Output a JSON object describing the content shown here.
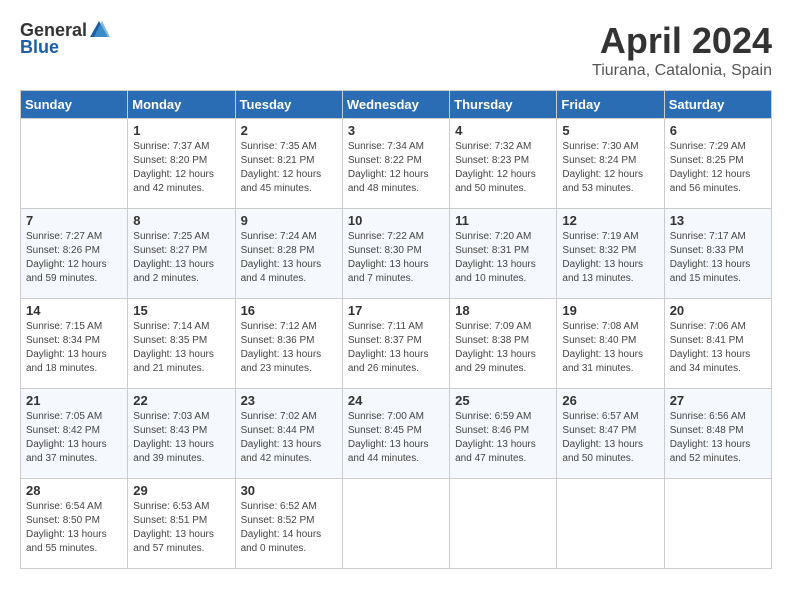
{
  "header": {
    "logo_general": "General",
    "logo_blue": "Blue",
    "main_title": "April 2024",
    "subtitle": "Tiurana, Catalonia, Spain"
  },
  "weekdays": [
    "Sunday",
    "Monday",
    "Tuesday",
    "Wednesday",
    "Thursday",
    "Friday",
    "Saturday"
  ],
  "weeks": [
    [
      {
        "num": "",
        "info": ""
      },
      {
        "num": "1",
        "info": "Sunrise: 7:37 AM\nSunset: 8:20 PM\nDaylight: 12 hours\nand 42 minutes."
      },
      {
        "num": "2",
        "info": "Sunrise: 7:35 AM\nSunset: 8:21 PM\nDaylight: 12 hours\nand 45 minutes."
      },
      {
        "num": "3",
        "info": "Sunrise: 7:34 AM\nSunset: 8:22 PM\nDaylight: 12 hours\nand 48 minutes."
      },
      {
        "num": "4",
        "info": "Sunrise: 7:32 AM\nSunset: 8:23 PM\nDaylight: 12 hours\nand 50 minutes."
      },
      {
        "num": "5",
        "info": "Sunrise: 7:30 AM\nSunset: 8:24 PM\nDaylight: 12 hours\nand 53 minutes."
      },
      {
        "num": "6",
        "info": "Sunrise: 7:29 AM\nSunset: 8:25 PM\nDaylight: 12 hours\nand 56 minutes."
      }
    ],
    [
      {
        "num": "7",
        "info": "Sunrise: 7:27 AM\nSunset: 8:26 PM\nDaylight: 12 hours\nand 59 minutes."
      },
      {
        "num": "8",
        "info": "Sunrise: 7:25 AM\nSunset: 8:27 PM\nDaylight: 13 hours\nand 2 minutes."
      },
      {
        "num": "9",
        "info": "Sunrise: 7:24 AM\nSunset: 8:28 PM\nDaylight: 13 hours\nand 4 minutes."
      },
      {
        "num": "10",
        "info": "Sunrise: 7:22 AM\nSunset: 8:30 PM\nDaylight: 13 hours\nand 7 minutes."
      },
      {
        "num": "11",
        "info": "Sunrise: 7:20 AM\nSunset: 8:31 PM\nDaylight: 13 hours\nand 10 minutes."
      },
      {
        "num": "12",
        "info": "Sunrise: 7:19 AM\nSunset: 8:32 PM\nDaylight: 13 hours\nand 13 minutes."
      },
      {
        "num": "13",
        "info": "Sunrise: 7:17 AM\nSunset: 8:33 PM\nDaylight: 13 hours\nand 15 minutes."
      }
    ],
    [
      {
        "num": "14",
        "info": "Sunrise: 7:15 AM\nSunset: 8:34 PM\nDaylight: 13 hours\nand 18 minutes."
      },
      {
        "num": "15",
        "info": "Sunrise: 7:14 AM\nSunset: 8:35 PM\nDaylight: 13 hours\nand 21 minutes."
      },
      {
        "num": "16",
        "info": "Sunrise: 7:12 AM\nSunset: 8:36 PM\nDaylight: 13 hours\nand 23 minutes."
      },
      {
        "num": "17",
        "info": "Sunrise: 7:11 AM\nSunset: 8:37 PM\nDaylight: 13 hours\nand 26 minutes."
      },
      {
        "num": "18",
        "info": "Sunrise: 7:09 AM\nSunset: 8:38 PM\nDaylight: 13 hours\nand 29 minutes."
      },
      {
        "num": "19",
        "info": "Sunrise: 7:08 AM\nSunset: 8:40 PM\nDaylight: 13 hours\nand 31 minutes."
      },
      {
        "num": "20",
        "info": "Sunrise: 7:06 AM\nSunset: 8:41 PM\nDaylight: 13 hours\nand 34 minutes."
      }
    ],
    [
      {
        "num": "21",
        "info": "Sunrise: 7:05 AM\nSunset: 8:42 PM\nDaylight: 13 hours\nand 37 minutes."
      },
      {
        "num": "22",
        "info": "Sunrise: 7:03 AM\nSunset: 8:43 PM\nDaylight: 13 hours\nand 39 minutes."
      },
      {
        "num": "23",
        "info": "Sunrise: 7:02 AM\nSunset: 8:44 PM\nDaylight: 13 hours\nand 42 minutes."
      },
      {
        "num": "24",
        "info": "Sunrise: 7:00 AM\nSunset: 8:45 PM\nDaylight: 13 hours\nand 44 minutes."
      },
      {
        "num": "25",
        "info": "Sunrise: 6:59 AM\nSunset: 8:46 PM\nDaylight: 13 hours\nand 47 minutes."
      },
      {
        "num": "26",
        "info": "Sunrise: 6:57 AM\nSunset: 8:47 PM\nDaylight: 13 hours\nand 50 minutes."
      },
      {
        "num": "27",
        "info": "Sunrise: 6:56 AM\nSunset: 8:48 PM\nDaylight: 13 hours\nand 52 minutes."
      }
    ],
    [
      {
        "num": "28",
        "info": "Sunrise: 6:54 AM\nSunset: 8:50 PM\nDaylight: 13 hours\nand 55 minutes."
      },
      {
        "num": "29",
        "info": "Sunrise: 6:53 AM\nSunset: 8:51 PM\nDaylight: 13 hours\nand 57 minutes."
      },
      {
        "num": "30",
        "info": "Sunrise: 6:52 AM\nSunset: 8:52 PM\nDaylight: 14 hours\nand 0 minutes."
      },
      {
        "num": "",
        "info": ""
      },
      {
        "num": "",
        "info": ""
      },
      {
        "num": "",
        "info": ""
      },
      {
        "num": "",
        "info": ""
      }
    ]
  ]
}
